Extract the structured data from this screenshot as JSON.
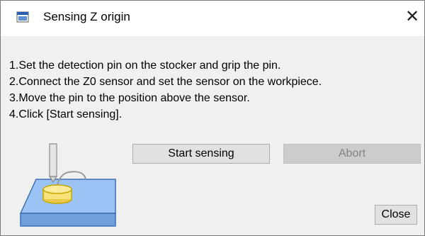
{
  "window": {
    "title": "Sensing Z origin",
    "title_icon": "app-window-icon",
    "close_icon": "close-icon",
    "close_glyph": "✕"
  },
  "instructions": [
    "1.Set the detection pin on the stocker and grip the pin.",
    "2.Connect the Z0 sensor and set the sensor on the workpiece.",
    "3.Move the pin to the position above the sensor.",
    "4.Click [Start sensing]."
  ],
  "buttons": {
    "start_label": "Start sensing",
    "abort_label": "Abort",
    "abort_enabled": false,
    "close_label": "Close"
  },
  "illustration": {
    "icon": "z-sensor-illustration",
    "colors": {
      "workpiece_fill": "#9cc3f5",
      "workpiece_stroke": "#3d6fb0",
      "sensor_fill": "#f7e27a",
      "sensor_stroke": "#c9a600",
      "pin_fill": "#e6e6e6",
      "pin_stroke": "#8a8a8a"
    }
  }
}
